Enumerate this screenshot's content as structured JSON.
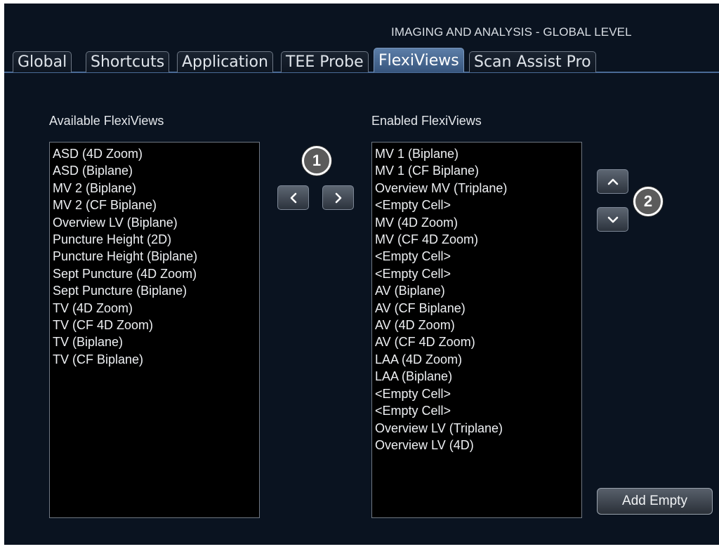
{
  "header": {
    "title": "IMAGING AND ANALYSIS - GLOBAL LEVEL"
  },
  "tabs": [
    {
      "label": "Global"
    },
    {
      "label": "Shortcuts"
    },
    {
      "label": "Application"
    },
    {
      "label": "TEE Probe"
    },
    {
      "label": "FlexiViews",
      "active": true
    },
    {
      "label": "Scan Assist Pro"
    }
  ],
  "available": {
    "label": "Available FlexiViews",
    "items": [
      "ASD (4D Zoom)",
      "ASD (Biplane)",
      "MV 2 (Biplane)",
      "MV 2 (CF Biplane)",
      "Overview LV (Biplane)",
      "Puncture Height (2D)",
      "Puncture Height (Biplane)",
      "Sept Puncture (4D Zoom)",
      "Sept Puncture (Biplane)",
      "TV (4D Zoom)",
      "TV (CF 4D Zoom)",
      "TV (Biplane)",
      "TV (CF Biplane)"
    ]
  },
  "enabled": {
    "label": "Enabled FlexiViews",
    "items": [
      "MV 1 (Biplane)",
      "MV 1 (CF Biplane)",
      "Overview MV (Triplane)",
      "<Empty Cell>",
      "MV (4D Zoom)",
      "MV (CF 4D Zoom)",
      "<Empty Cell>",
      "<Empty Cell>",
      "AV (Biplane)",
      "AV (CF Biplane)",
      "AV (4D Zoom)",
      "AV (CF 4D Zoom)",
      "LAA (4D Zoom)",
      "LAA (Biplane)",
      "<Empty Cell>",
      "<Empty Cell>",
      "Overview LV (Triplane)",
      "Overview LV (4D)"
    ]
  },
  "callouts": {
    "transfer": "1",
    "reorder": "2"
  },
  "icons": {
    "move_left": "chevron-left-icon",
    "move_right": "chevron-right-icon",
    "move_up": "chevron-up-icon",
    "move_down": "chevron-down-icon"
  },
  "buttons": {
    "add_empty": "Add Empty"
  },
  "colors": {
    "background": "#0a1320",
    "active_tab": "#4a6b96",
    "list_background": "#000000",
    "text": "#eef0f3"
  }
}
